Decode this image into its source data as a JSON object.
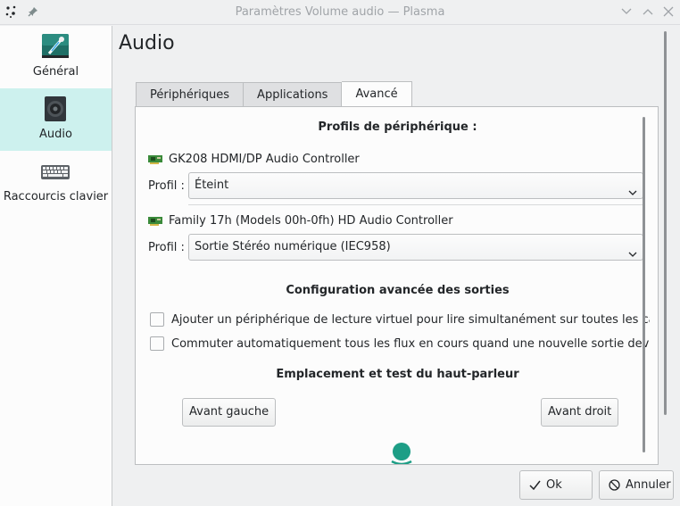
{
  "window": {
    "title": "Paramètres Volume audio — Plasma",
    "icons": [
      "app-icon",
      "pin-icon",
      "minimize-icon",
      "maximize-icon",
      "close-icon"
    ]
  },
  "sidebar": {
    "items": [
      {
        "label": "Général",
        "icon": "general-icon",
        "active": false
      },
      {
        "label": "Audio",
        "icon": "speaker-icon",
        "active": true
      },
      {
        "label": "Raccourcis clavier",
        "icon": "keyboard-icon",
        "active": false
      }
    ]
  },
  "page": {
    "title": "Audio",
    "tabs": [
      {
        "label": "Périphériques",
        "active": false
      },
      {
        "label": "Applications",
        "active": false
      },
      {
        "label": "Avancé",
        "active": true
      }
    ]
  },
  "advanced": {
    "profiles_heading": "Profils de périphérique :",
    "devices": [
      {
        "name": "GK208 HDMI/DP Audio Controller",
        "profile_label": "Profil :",
        "profile_value": "Éteint"
      },
      {
        "name": "Family 17h (Models 00h-0fh) HD Audio Controller",
        "profile_label": "Profil :",
        "profile_value": "Sortie Stéréo numérique (IEC958)"
      }
    ],
    "outputs_heading": "Configuration avancée des sorties",
    "options": [
      {
        "label": "Ajouter un périphérique de lecture virtuel pour lire simultanément sur toutes les cart...",
        "checked": false
      },
      {
        "label": "Commuter automatiquement tous les flux en cours quand une nouvelle sortie devien...",
        "checked": false
      }
    ],
    "speaker_heading": "Emplacement et test du haut-parleur",
    "speaker_buttons": {
      "front_left": "Avant gauche",
      "front_right": "Avant droit"
    }
  },
  "dialog": {
    "ok": "Ok",
    "cancel": "Annuler"
  },
  "colors": {
    "accent": "#3daee9",
    "active_sidebar": "#cdf1ee",
    "listener": "#1d9e86"
  }
}
